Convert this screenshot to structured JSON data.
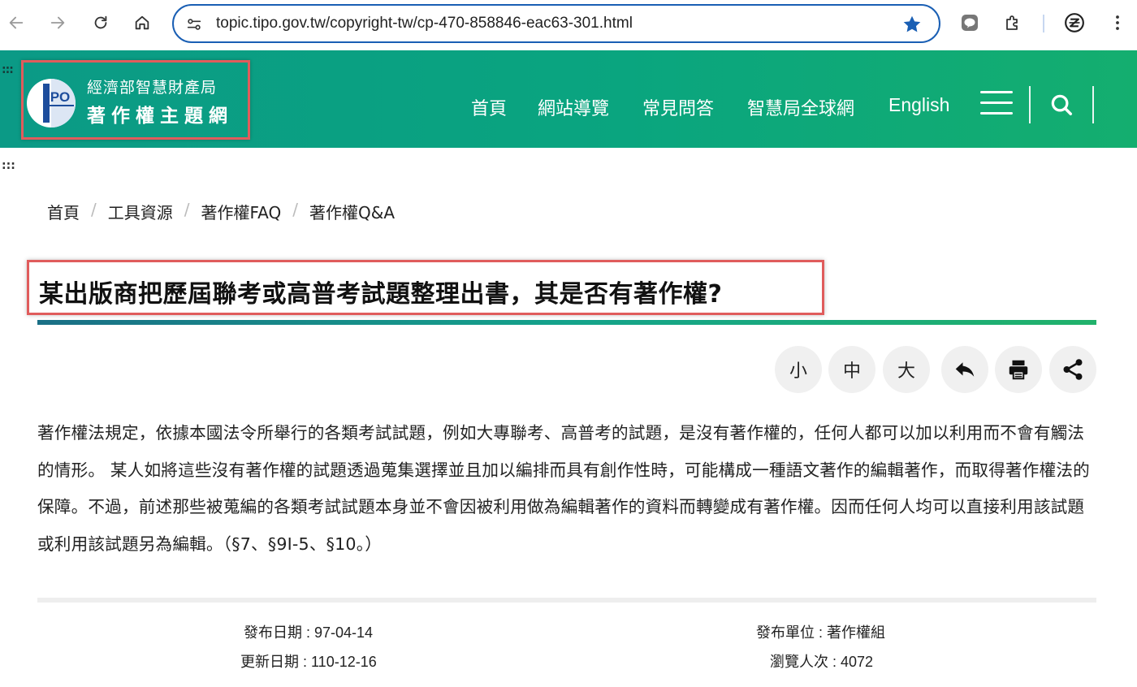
{
  "browser": {
    "url": "topic.tipo.gov.tw/copyright-tw/cp-470-858846-eac63-301.html"
  },
  "header": {
    "logo_line1": "經濟部智慧財產局",
    "logo_line2": "著作權主題網",
    "nav": [
      "首頁",
      "網站導覽",
      "常見問答",
      "智慧局全球網",
      "English"
    ],
    "accent_color": "#0aa57f"
  },
  "accessibility_marker": ":::",
  "breadcrumb": [
    "首頁",
    "工具資源",
    "著作權FAQ",
    "著作權Q&A"
  ],
  "breadcrumb_separator": "/",
  "title": "某出版商把歷屆聯考或高普考試題整理出書，其是否有著作權?",
  "tools": {
    "font_small": "小",
    "font_medium": "中",
    "font_large": "大"
  },
  "body": "著作權法規定，依據本國法令所舉行的各類考試試題，例如大專聯考、高普考的試題，是沒有著作權的，任何人都可以加以利用而不會有觸法的情形。 某人如將這些沒有著作權的試題透過蒐集選擇並且加以編排而具有創作性時，可能構成一種語文著作的編輯著作，而取得著作權法的保障。不過，前述那些被蒐編的各類考試試題本身並不會因被利用做為編輯著作的資料而轉變成有著作權。因而任何人均可以直接利用該試題或利用該試題另為編輯。（§7、§9I-5、§10。）",
  "meta": {
    "publish_date": "發布日期 : 97-04-14",
    "update_date": "更新日期 : 110-12-16",
    "publisher": "發布單位 : 著作權組",
    "views": "瀏覽人次 : 4072"
  }
}
